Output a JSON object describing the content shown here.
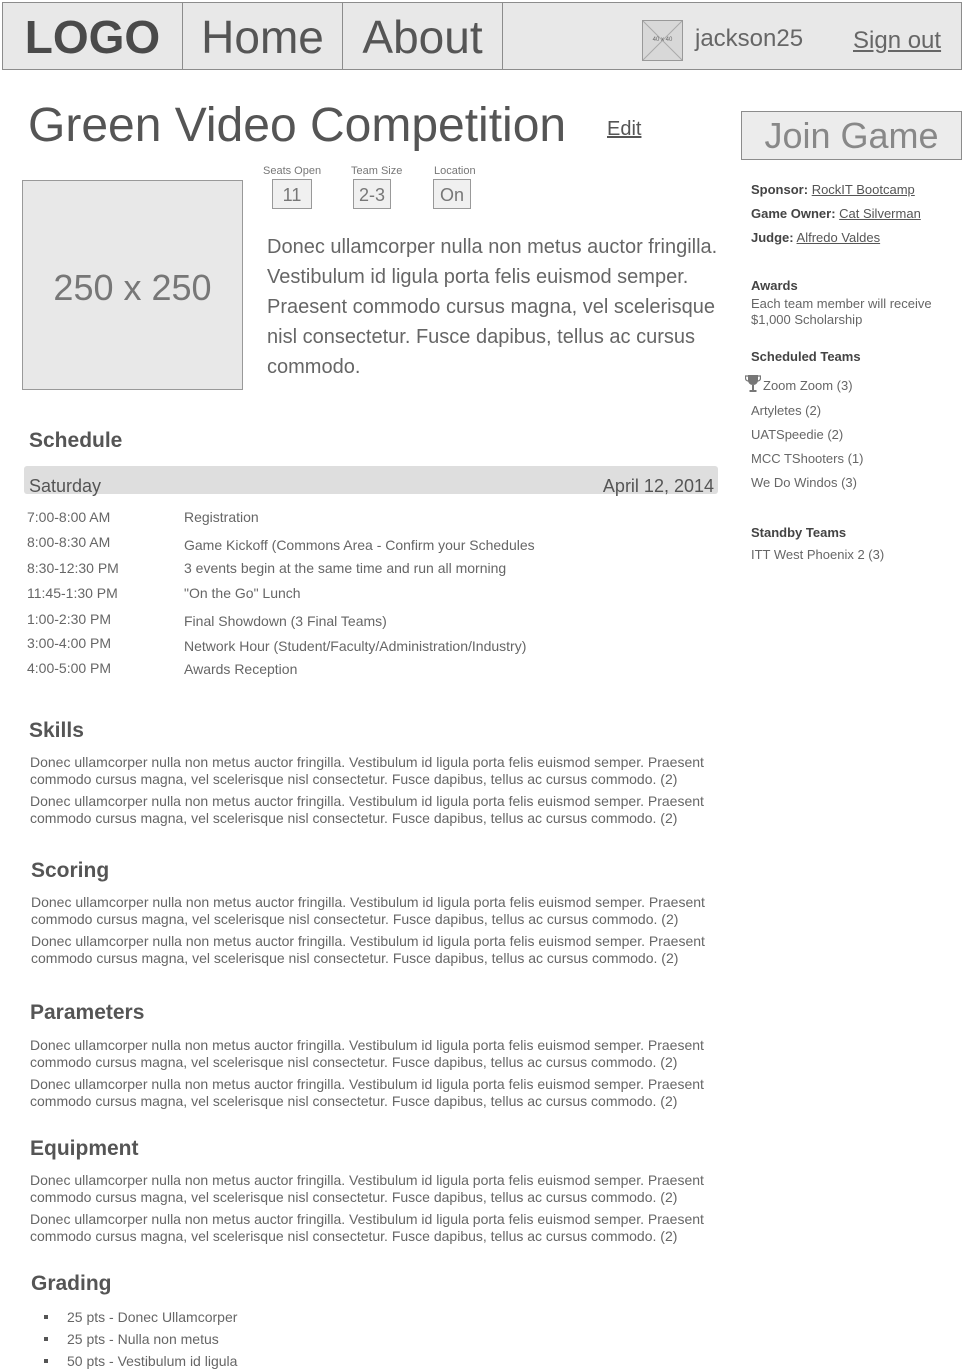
{
  "nav": {
    "logo": "LOGO",
    "home": "Home",
    "about": "About",
    "avatar_label": "40 x 40",
    "username": "jackson25",
    "signout": "Sign out"
  },
  "game": {
    "title": "Green Video Competition",
    "edit": "Edit",
    "image_placeholder": "250 x 250",
    "stats": {
      "seats_open_label": "Seats Open",
      "seats_open_value": "11",
      "team_size_label": "Team Size",
      "team_size_value": "2-3",
      "location_label": "Location",
      "location_value": "On"
    },
    "description": "Donec ullamcorper nulla non metus auctor fringilla. Vestibulum id ligula porta felis euismod semper. Praesent commodo cursus magna, vel scelerisque nisl consectetur. Fusce dapibus, tellus ac cursus commodo."
  },
  "sidebar": {
    "join_button": "Join Game",
    "sponsor_label": "Sponsor:",
    "sponsor_value": "RockIT Bootcamp",
    "owner_label": "Game Owner:",
    "owner_value": "Cat Silverman",
    "judge_label": "Judge:",
    "judge_value": "Alfredo Valdes",
    "awards_heading": "Awards",
    "awards_text_1": "Each team member will receive",
    "awards_text_2": "$1,000 Scholarship",
    "scheduled_heading": "Scheduled Teams",
    "scheduled_teams": [
      "Zoom Zoom (3)",
      "Artyletes (2)",
      "UATSpeedie (2)",
      "MCC TShooters (1)",
      "We Do Windos (3)"
    ],
    "standby_heading": "Standby Teams",
    "standby_teams": [
      "ITT West Phoenix 2 (3)"
    ]
  },
  "schedule": {
    "heading": "Schedule",
    "day": "Saturday",
    "date": "April 12, 2014",
    "rows": [
      {
        "time": "7:00-8:00 AM",
        "event": "Registration"
      },
      {
        "time": "8:00-8:30 AM",
        "event": "Game Kickoff (Commons Area - Confirm your Schedules"
      },
      {
        "time": "8:30-12:30 PM",
        "event": "3 events begin at the same time and run all morning"
      },
      {
        "time": "11:45-1:30 PM",
        "event": "\"On the Go\" Lunch"
      },
      {
        "time": "1:00-2:30 PM",
        "event": "Final Showdown (3 Final Teams)"
      },
      {
        "time": "3:00-4:00 PM",
        "event": "Network Hour (Student/Faculty/Administration/Industry)"
      },
      {
        "time": "4:00-5:00 PM",
        "event": "Awards Reception"
      }
    ]
  },
  "sections": {
    "skills": {
      "heading": "Skills",
      "paragraphs": [
        "Donec ullamcorper nulla non metus auctor fringilla. Vestibulum id ligula porta felis euismod semper. Praesent commodo cursus magna, vel scelerisque nisl consectetur. Fusce dapibus, tellus ac cursus commodo. (2)",
        "Donec ullamcorper nulla non metus auctor fringilla. Vestibulum id ligula porta felis euismod semper. Praesent commodo cursus magna, vel scelerisque nisl consectetur. Fusce dapibus, tellus ac cursus commodo. (2)"
      ]
    },
    "scoring": {
      "heading": "Scoring",
      "paragraphs": [
        "Donec ullamcorper nulla non metus auctor fringilla. Vestibulum id ligula porta felis euismod semper. Praesent commodo cursus magna, vel scelerisque nisl consectetur. Fusce dapibus, tellus ac cursus commodo. (2)",
        "Donec ullamcorper nulla non metus auctor fringilla. Vestibulum id ligula porta felis euismod semper. Praesent commodo cursus magna, vel scelerisque nisl consectetur. Fusce dapibus, tellus ac cursus commodo. (2)"
      ]
    },
    "parameters": {
      "heading": "Parameters",
      "paragraphs": [
        "Donec ullamcorper nulla non metus auctor fringilla. Vestibulum id ligula porta felis euismod semper. Praesent commodo cursus magna, vel scelerisque nisl consectetur. Fusce dapibus, tellus ac cursus commodo. (2)",
        "Donec ullamcorper nulla non metus auctor fringilla. Vestibulum id ligula porta felis euismod semper. Praesent commodo cursus magna, vel scelerisque nisl consectetur. Fusce dapibus, tellus ac cursus commodo. (2)"
      ]
    },
    "equipment": {
      "heading": "Equipment",
      "paragraphs": [
        "Donec ullamcorper nulla non metus auctor fringilla. Vestibulum id ligula porta felis euismod semper. Praesent commodo cursus magna, vel scelerisque nisl consectetur. Fusce dapibus, tellus ac cursus commodo. (2)",
        "Donec ullamcorper nulla non metus auctor fringilla. Vestibulum id ligula porta felis euismod semper. Praesent commodo cursus magna, vel scelerisque nisl consectetur. Fusce dapibus, tellus ac cursus commodo. (2)"
      ]
    },
    "grading": {
      "heading": "Grading",
      "items": [
        "25 pts - Donec Ullamcorper",
        "25 pts - Nulla non metus",
        "50 pts - Vestibulum id ligula"
      ]
    }
  },
  "icons": {
    "trophy": "trophy-icon",
    "avatar": "avatar-placeholder-icon"
  }
}
